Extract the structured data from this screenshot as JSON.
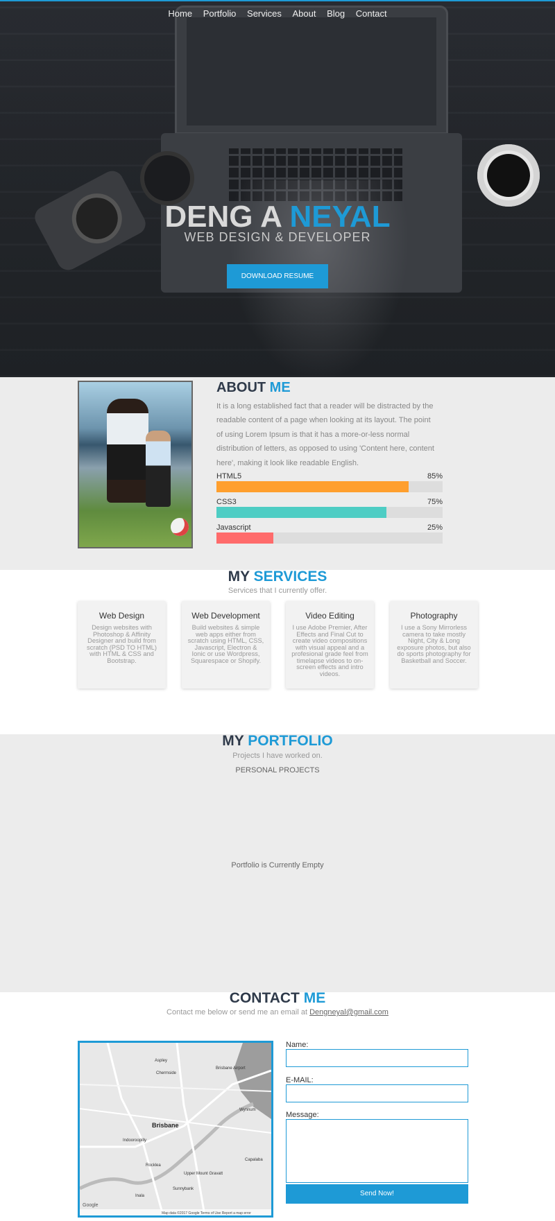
{
  "nav": {
    "items": [
      "Home",
      "Portfolio",
      "Services",
      "About",
      "Blog",
      "Contact"
    ]
  },
  "hero": {
    "name_first": "DENG A",
    "name_last": "NEYAL",
    "subtitle": "WEB DESIGN & DEVELOPER",
    "button_label": "DOWNLOAD RESUME"
  },
  "about": {
    "title_first": "ABOUT",
    "title_last": "ME",
    "text": "It is a long established fact that a reader will be distracted by the readable content of a page when looking at its layout. The point of using Lorem Ipsum is that it has a more-or-less normal distribution of letters, as opposed to using 'Content here, content here', making it look like readable English.",
    "skills": [
      {
        "name": "HTML5",
        "percent_label": "85%",
        "level": 0.85,
        "color": "#ff9f2e"
      },
      {
        "name": "CSS3",
        "percent_label": "75%",
        "level": 0.75,
        "color": "#4ecdc4"
      },
      {
        "name": "Javascript",
        "percent_label": "25%",
        "level": 0.25,
        "color": "#ff6b6b"
      }
    ]
  },
  "services": {
    "title_first": "MY",
    "title_last": "SERVICES",
    "subtitle": "Services that I currently offer.",
    "cards": [
      {
        "title": "Web Design",
        "text": "Design websites with Photoshop & Affinity Designer and build from scratch (PSD TO HTML) with HTML & CSS and Bootstrap."
      },
      {
        "title": "Web Development",
        "text": "Build websites & simple web apps either from scratch using HTML, CSS, Javascript, Electron & Ionic or use Wordpress, Squarespace or Shopify."
      },
      {
        "title": "Video Editing",
        "text": "I use Adobe Premier, After Effects and Final Cut to create video compositions with visual appeal and a profesional grade feel from timelapse videos to on-screen effects and intro videos."
      },
      {
        "title": "Photography",
        "text": "I use a Sony Mirrorless camera to take mostly Night, City & Long exposure photos, but also do sports photography for Basketball and Soccer."
      }
    ]
  },
  "portfolio": {
    "title_first": "MY",
    "title_last": "PORTFOLIO",
    "subtitle": "Projects I have worked on.",
    "tab": "PERSONAL PROJECTS",
    "empty_text": "Portfolio is Currently Empty"
  },
  "contact": {
    "title_first": "CONTACT",
    "title_last": "ME",
    "subtitle_prefix": "Contact me below or send me an email at",
    "email": "Dengneyal@gmail.com",
    "name_label": "Name:",
    "email_label": "E-MAIL:",
    "message_label": "Message:",
    "send_label": "Send Now!",
    "map": {
      "places": [
        "Aspley",
        "Chermside",
        "Brisbane Airport",
        "Brisbane",
        "Indooroopilly",
        "Wynnum",
        "Capalaba",
        "Upper Mount Gravatt",
        "Rocklea",
        "Sunnybank",
        "Inala"
      ],
      "footer": "Map data ©2017 Google   Terms of Use   Report a map error",
      "logo": "Google"
    }
  },
  "colors": {
    "accent": "#1e9ad6",
    "heading": "#2f3a4a",
    "section_grey": "#ececec"
  }
}
